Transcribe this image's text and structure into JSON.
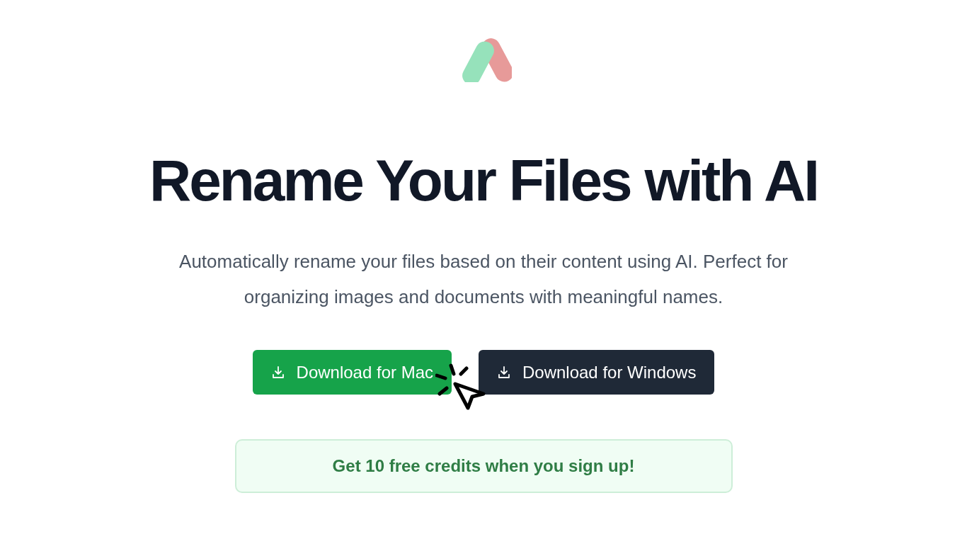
{
  "headline": "Rename Your Files with AI",
  "subtitle": "Automatically rename your files based on their content using AI. Perfect for organizing images and documents with meaningful names.",
  "buttons": [
    {
      "kind": "mac",
      "label": "Download for Mac"
    },
    {
      "kind": "windows",
      "label": "Download for Windows"
    }
  ],
  "banner": "Get 10 free credits when you sign up!"
}
